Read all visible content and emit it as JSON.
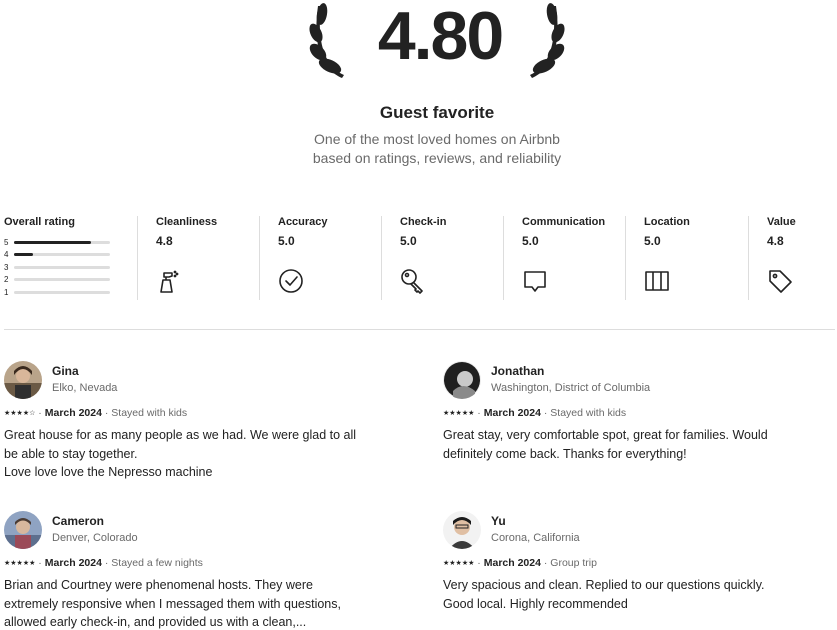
{
  "hero": {
    "score": "4.80",
    "title": "Guest favorite",
    "subtitle_line1": "One of the most loved homes on Airbnb",
    "subtitle_line2": "based on ratings, reviews, and reliability"
  },
  "overall_rating": {
    "label": "Overall rating",
    "bars": [
      {
        "stars": "5",
        "fraction": 0.8
      },
      {
        "stars": "4",
        "fraction": 0.2
      },
      {
        "stars": "3",
        "fraction": 0
      },
      {
        "stars": "2",
        "fraction": 0
      },
      {
        "stars": "1",
        "fraction": 0
      }
    ]
  },
  "categories": [
    {
      "label": "Cleanliness",
      "value": "4.8",
      "icon": "spray-bottle-icon"
    },
    {
      "label": "Accuracy",
      "value": "5.0",
      "icon": "check-circle-icon"
    },
    {
      "label": "Check-in",
      "value": "5.0",
      "icon": "key-icon"
    },
    {
      "label": "Communication",
      "value": "5.0",
      "icon": "chat-bubble-icon"
    },
    {
      "label": "Location",
      "value": "5.0",
      "icon": "map-icon"
    },
    {
      "label": "Value",
      "value": "4.8",
      "icon": "price-tag-icon"
    }
  ],
  "reviews": [
    {
      "name": "Gina",
      "location": "Elko, Nevada",
      "stars": "★★★★☆",
      "date": "March 2024",
      "stay": "Stayed with kids",
      "text": [
        "Great house for as many people as we had. We were glad to all",
        "be able to stay together.",
        "Love love love the Nepresso machine"
      ]
    },
    {
      "name": "Jonathan",
      "location": "Washington, District of Columbia",
      "stars": "★★★★★",
      "date": "March 2024",
      "stay": "Stayed with kids",
      "text": [
        "Great stay, very comfortable spot, great for families. Would",
        "definitely come back. Thanks for everything!"
      ]
    },
    {
      "name": "Cameron",
      "location": "Denver, Colorado",
      "stars": "★★★★★",
      "date": "March 2024",
      "stay": "Stayed a few nights",
      "text": [
        "Brian and Courtney were phenomenal hosts. They were",
        "extremely responsive when I messaged them with questions,",
        "allowed early check-in, and provided us with a clean,..."
      ]
    },
    {
      "name": "Yu",
      "location": "Corona, California",
      "stars": "★★★★★",
      "date": "March 2024",
      "stay": "Group trip",
      "text": [
        "Very spacious and clean. Replied to our questions quickly.",
        "Good local. Highly recommended"
      ]
    }
  ],
  "meta_separator": " · ",
  "colors": {
    "text": "#222222",
    "muted": "#6a6a6a",
    "divider": "#dddddd"
  }
}
